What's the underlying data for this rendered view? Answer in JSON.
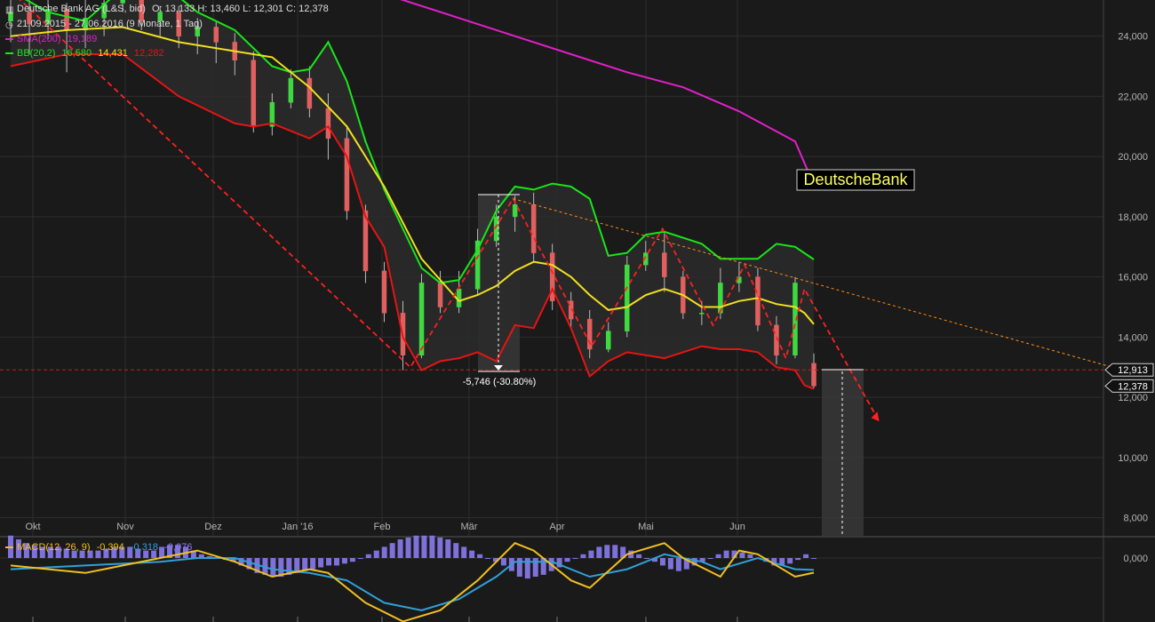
{
  "header": {
    "instrument": "Deutsche Bank AG (L&S, bid)",
    "ohlc": "O: 13,133  H: 13,460  L: 12,301  C: 12,378",
    "range": "21.09.2015 - 27.06.2016 (9 Monate, 1 Tag)",
    "sma_label": "SMA(200)",
    "sma_value": "19,189",
    "bb_label": "BB(20,2)",
    "bb_upper": "16,580",
    "bb_mid": "14,431",
    "bb_lower": "12,282",
    "macd_label": "MACD(12, 26, 9)",
    "macd_value": "-0,394",
    "macd_signal": "-0,318",
    "macd_hist": "-0,076"
  },
  "colors": {
    "background": "#1a1a1a",
    "grid": "#2e2e2e",
    "sma": "#e020c8",
    "bb_upper": "#19e619",
    "bb_mid": "#f0e01e",
    "bb_lower": "#e61414",
    "up_candle": "#40d840",
    "down_candle": "#e06060",
    "macd": "#f0c020",
    "signal": "#30a0d8",
    "hist": "#8a7cf0",
    "trend": "#ff2020",
    "resistance": "#ff8c1a"
  },
  "icons": {
    "chart_icon": "bar-chart-icon",
    "clock_icon": "clock-icon"
  },
  "watermark": "DeutscheBank",
  "annotations": {
    "drop_label": "-5,746 (-30.80%)",
    "price_marker_1": "12,913",
    "price_marker_2": "12,378"
  },
  "chart_data": {
    "type": "candlestick",
    "title": "Deutsche Bank AG (L&S, bid)",
    "x_ticks": [
      "Okt",
      "Nov",
      "Dez",
      "Jan '16",
      "Feb",
      "Mär",
      "Apr",
      "Mai",
      "Jun"
    ],
    "y_ticks": [
      "24,000",
      "22,000",
      "20,000",
      "18,000",
      "16,000",
      "14,000",
      "12,000",
      "10,000",
      "8,000"
    ],
    "y_tick_values": [
      24,
      22,
      20,
      18,
      16,
      14,
      12,
      10,
      8
    ],
    "ylim": [
      7.4,
      25.2
    ],
    "macd_y_ticks": [
      "0,000"
    ],
    "grid": true,
    "sma200": [
      [
        0,
        29.0
      ],
      [
        3,
        28.6
      ],
      [
        6,
        28.1
      ],
      [
        9,
        27.6
      ],
      [
        12,
        27.0
      ],
      [
        15,
        26.4
      ],
      [
        18,
        25.8
      ],
      [
        21,
        25.2
      ],
      [
        24,
        24.6
      ],
      [
        27,
        24.0
      ],
      [
        30,
        23.4
      ],
      [
        33,
        22.8
      ],
      [
        36,
        22.3
      ],
      [
        39,
        21.5
      ],
      [
        42,
        20.5
      ],
      [
        42.8,
        19.35
      ],
      [
        43,
        19.19
      ]
    ],
    "bb_upper": [
      [
        0,
        25.5
      ],
      [
        2,
        24.8
      ],
      [
        4,
        24.5
      ],
      [
        6,
        25.6
      ],
      [
        8,
        25.8
      ],
      [
        10,
        24.8
      ],
      [
        12,
        24.2
      ],
      [
        14,
        23.0
      ],
      [
        15,
        22.8
      ],
      [
        16,
        22.9
      ],
      [
        17,
        23.8
      ],
      [
        18,
        22.5
      ],
      [
        19,
        20.5
      ],
      [
        20,
        18.9
      ],
      [
        21,
        17.6
      ],
      [
        22,
        16.3
      ],
      [
        23,
        15.8
      ],
      [
        24,
        15.9
      ],
      [
        25,
        16.9
      ],
      [
        26,
        18.2
      ],
      [
        27,
        19.0
      ],
      [
        28,
        18.9
      ],
      [
        29,
        19.1
      ],
      [
        30,
        19.0
      ],
      [
        31,
        18.6
      ],
      [
        32,
        16.7
      ],
      [
        33,
        16.8
      ],
      [
        34,
        17.4
      ],
      [
        35,
        17.5
      ],
      [
        36,
        17.3
      ],
      [
        37,
        17.1
      ],
      [
        38,
        16.6
      ],
      [
        39,
        16.6
      ],
      [
        40,
        16.6
      ],
      [
        41,
        17.1
      ],
      [
        42,
        17.0
      ],
      [
        43,
        16.58
      ]
    ],
    "bb_mid": [
      [
        0,
        24.0
      ],
      [
        3,
        24.2
      ],
      [
        6,
        24.3
      ],
      [
        9,
        23.8
      ],
      [
        12,
        23.5
      ],
      [
        14,
        23.3
      ],
      [
        16,
        22.3
      ],
      [
        18,
        21.0
      ],
      [
        20,
        19.0
      ],
      [
        22,
        16.6
      ],
      [
        24,
        15.2
      ],
      [
        25,
        15.4
      ],
      [
        26,
        15.7
      ],
      [
        27,
        16.2
      ],
      [
        28,
        16.5
      ],
      [
        29,
        16.4
      ],
      [
        30,
        16.0
      ],
      [
        31,
        15.4
      ],
      [
        32,
        14.9
      ],
      [
        33,
        15.0
      ],
      [
        34,
        15.4
      ],
      [
        35,
        15.6
      ],
      [
        36,
        15.4
      ],
      [
        37,
        15.0
      ],
      [
        38,
        15.0
      ],
      [
        39,
        15.2
      ],
      [
        40,
        15.3
      ],
      [
        41,
        15.1
      ],
      [
        42,
        15.0
      ],
      [
        42.5,
        14.8
      ],
      [
        43,
        14.43
      ]
    ],
    "bb_lower": [
      [
        0,
        23.0
      ],
      [
        3,
        23.4
      ],
      [
        6,
        23.4
      ],
      [
        9,
        22.0
      ],
      [
        12,
        21.1
      ],
      [
        13,
        21.0
      ],
      [
        14,
        21.1
      ],
      [
        16,
        20.6
      ],
      [
        17,
        21.0
      ],
      [
        18,
        20.0
      ],
      [
        19,
        18.0
      ],
      [
        20,
        17.0
      ],
      [
        21,
        14.0
      ],
      [
        22,
        12.9
      ],
      [
        23,
        13.2
      ],
      [
        24,
        13.3
      ],
      [
        25,
        13.5
      ],
      [
        26,
        13.2
      ],
      [
        27,
        14.4
      ],
      [
        28,
        14.3
      ],
      [
        29,
        15.6
      ],
      [
        30,
        14.3
      ],
      [
        31,
        12.7
      ],
      [
        32,
        13.2
      ],
      [
        33,
        13.5
      ],
      [
        34,
        13.4
      ],
      [
        35,
        13.3
      ],
      [
        36,
        13.5
      ],
      [
        37,
        13.7
      ],
      [
        38,
        13.6
      ],
      [
        39,
        13.6
      ],
      [
        40,
        13.5
      ],
      [
        41,
        13.0
      ],
      [
        42,
        12.9
      ],
      [
        42.5,
        12.4
      ],
      [
        43,
        12.28
      ]
    ],
    "candles": [
      [
        0,
        24.5,
        24.8,
        25.4,
        23.8
      ],
      [
        1,
        24.8,
        24.4,
        25.2,
        23.4
      ],
      [
        2,
        24.4,
        24.9,
        25.3,
        23.9
      ],
      [
        3,
        24.9,
        24.2,
        25.1,
        22.8
      ],
      [
        4,
        24.2,
        24.6,
        25.2,
        23.6
      ],
      [
        5,
        24.6,
        25.1,
        25.6,
        24.0
      ],
      [
        6,
        25.1,
        25.3,
        25.8,
        24.8
      ],
      [
        7,
        25.3,
        24.5,
        25.5,
        24.2
      ],
      [
        8,
        24.5,
        24.8,
        25.0,
        24.0
      ],
      [
        9,
        24.8,
        24.0,
        25.0,
        23.6
      ],
      [
        10,
        24.0,
        24.3,
        24.6,
        23.4
      ],
      [
        11,
        24.3,
        23.8,
        24.5,
        23.1
      ],
      [
        12,
        23.8,
        23.2,
        24.1,
        22.7
      ],
      [
        13,
        23.2,
        21.0,
        23.5,
        20.8
      ],
      [
        14,
        21.0,
        21.8,
        22.1,
        20.7
      ],
      [
        15,
        21.8,
        22.6,
        22.9,
        21.6
      ],
      [
        16,
        22.6,
        21.6,
        23.0,
        21.3
      ],
      [
        17,
        21.6,
        20.6,
        22.1,
        19.9
      ],
      [
        18,
        20.6,
        18.2,
        21.0,
        17.9
      ],
      [
        19,
        18.2,
        16.2,
        18.4,
        15.8
      ],
      [
        20,
        16.2,
        14.8,
        16.5,
        14.5
      ],
      [
        21,
        14.8,
        13.4,
        15.2,
        12.9
      ],
      [
        22,
        13.4,
        15.8,
        16.1,
        13.3
      ],
      [
        23,
        15.8,
        15.0,
        16.2,
        14.8
      ],
      [
        24,
        15.0,
        15.6,
        16.2,
        14.8
      ],
      [
        25,
        15.6,
        17.2,
        17.6,
        15.4
      ],
      [
        26,
        17.2,
        18.0,
        18.4,
        17.0
      ],
      [
        27,
        18.0,
        18.4,
        18.7,
        17.5
      ],
      [
        28,
        18.4,
        16.8,
        18.8,
        16.5
      ],
      [
        29,
        16.8,
        15.2,
        17.1,
        14.9
      ],
      [
        30,
        15.2,
        14.6,
        15.5,
        14.3
      ],
      [
        31,
        14.6,
        13.6,
        14.9,
        13.3
      ],
      [
        32,
        13.6,
        14.2,
        14.5,
        13.5
      ],
      [
        33,
        14.2,
        16.4,
        16.7,
        14.0
      ],
      [
        34,
        16.4,
        16.8,
        17.2,
        16.2
      ],
      [
        35,
        16.8,
        16.0,
        17.5,
        15.5
      ],
      [
        36,
        16.0,
        14.8,
        16.2,
        14.6
      ],
      [
        37,
        14.8,
        14.8,
        15.2,
        14.4
      ],
      [
        38,
        14.8,
        15.8,
        16.3,
        14.6
      ],
      [
        39,
        15.8,
        16.0,
        16.5,
        15.5
      ],
      [
        40,
        16.0,
        14.4,
        16.3,
        14.2
      ],
      [
        41,
        14.4,
        13.4,
        14.7,
        13.1
      ],
      [
        42,
        13.4,
        15.8,
        16.0,
        13.3
      ],
      [
        43,
        13.13,
        12.378,
        13.46,
        12.301
      ]
    ],
    "macd_hist": [
      0.6,
      0.5,
      0.4,
      0.35,
      0.3,
      0.3,
      0.3,
      0.25,
      0.2,
      0.2,
      0.2,
      0.2,
      0.25,
      0.3,
      0.3,
      0.3,
      0.25,
      0.2,
      0.2,
      0.3,
      0.35,
      0.35,
      0.3,
      0.2,
      0.1,
      0.05,
      0.0,
      -0.05,
      -0.1,
      -0.2,
      -0.3,
      -0.4,
      -0.45,
      -0.5,
      -0.5,
      -0.45,
      -0.4,
      -0.35,
      -0.3,
      -0.25,
      -0.2,
      -0.2,
      -0.15,
      -0.1,
      0.0,
      0.1,
      0.2,
      0.3,
      0.4,
      0.5,
      0.55,
      0.6,
      0.6,
      0.6,
      0.55,
      0.5,
      0.4,
      0.3,
      0.2,
      0.1,
      0.0,
      -0.1,
      -0.2,
      -0.35,
      -0.5,
      -0.55,
      -0.5,
      -0.45,
      -0.35,
      -0.25,
      -0.1,
      0.0,
      0.1,
      0.2,
      0.3,
      0.35,
      0.35,
      0.3,
      0.2,
      0.1,
      0.0,
      -0.1,
      -0.2,
      -0.3,
      -0.35,
      -0.3,
      -0.2,
      -0.1,
      0.0,
      0.1,
      0.2,
      0.2,
      0.15,
      0.1,
      0.0,
      -0.1,
      -0.2,
      -0.2,
      -0.15,
      -0.05,
      0.1,
      0.0
    ],
    "macd_line": [
      [
        0,
        -0.2
      ],
      [
        4,
        -0.4
      ],
      [
        8,
        0.0
      ],
      [
        10,
        0.2
      ],
      [
        12,
        -0.1
      ],
      [
        14,
        -0.5
      ],
      [
        16,
        -0.3
      ],
      [
        17,
        -0.4
      ],
      [
        19,
        -1.2
      ],
      [
        21,
        -1.7
      ],
      [
        23,
        -1.4
      ],
      [
        25,
        -0.6
      ],
      [
        27,
        0.4
      ],
      [
        28,
        0.2
      ],
      [
        30,
        -0.6
      ],
      [
        31,
        -0.8
      ],
      [
        33,
        0.1
      ],
      [
        35,
        0.4
      ],
      [
        36,
        0.0
      ],
      [
        38,
        -0.5
      ],
      [
        39,
        0.2
      ],
      [
        40,
        0.1
      ],
      [
        42,
        -0.5
      ],
      [
        43,
        -0.394
      ]
    ],
    "macd_signal_line": [
      [
        0,
        -0.3
      ],
      [
        4,
        -0.2
      ],
      [
        8,
        -0.1
      ],
      [
        10,
        0.0
      ],
      [
        12,
        0.0
      ],
      [
        14,
        -0.3
      ],
      [
        16,
        -0.4
      ],
      [
        18,
        -0.6
      ],
      [
        20,
        -1.2
      ],
      [
        22,
        -1.4
      ],
      [
        24,
        -1.1
      ],
      [
        26,
        -0.5
      ],
      [
        27,
        -0.1
      ],
      [
        29,
        -0.1
      ],
      [
        31,
        -0.5
      ],
      [
        33,
        -0.3
      ],
      [
        35,
        0.1
      ],
      [
        37,
        -0.1
      ],
      [
        38,
        -0.3
      ],
      [
        40,
        0.0
      ],
      [
        42,
        -0.3
      ],
      [
        43,
        -0.318
      ]
    ]
  }
}
